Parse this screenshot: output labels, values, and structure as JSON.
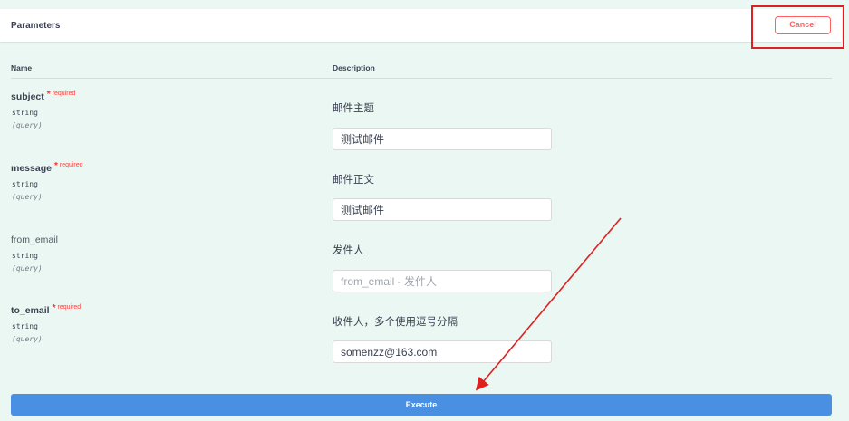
{
  "section": {
    "title": "Parameters",
    "cancel_label": "Cancel"
  },
  "columns": {
    "name": "Name",
    "description": "Description"
  },
  "params": [
    {
      "name": "subject",
      "required_star": "*",
      "required_label": "required",
      "type": "string",
      "in": "(query)",
      "description": "邮件主题",
      "value": "测试邮件",
      "placeholder": ""
    },
    {
      "name": "message",
      "required_star": "*",
      "required_label": "required",
      "type": "string",
      "in": "(query)",
      "description": "邮件正文",
      "value": "测试邮件",
      "placeholder": ""
    },
    {
      "name": "from_email",
      "type": "string",
      "in": "(query)",
      "description": "发件人",
      "value": "",
      "placeholder": "from_email - 发件人"
    },
    {
      "name": "to_email",
      "required_star": "*",
      "required_label": "required",
      "type": "string",
      "in": "(query)",
      "description": "收件人，多个使用逗号分隔",
      "value": "somenzz@163.com",
      "placeholder": ""
    }
  ],
  "execute_label": "Execute",
  "colors": {
    "background": "#ebf7f2",
    "accent": "#4990e2",
    "cancel": "#ff6060",
    "required": "#ff3030",
    "annotation": "#e02020"
  }
}
